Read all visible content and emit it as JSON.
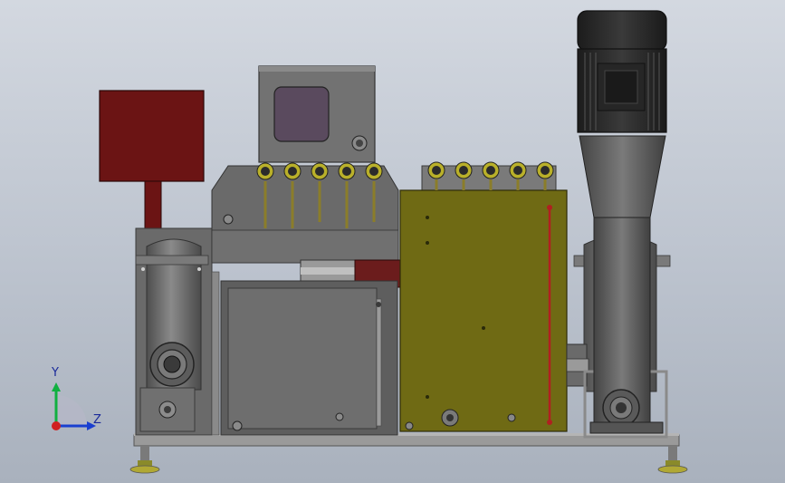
{
  "viewport": {
    "background_top": "#d3d8e0",
    "background_bottom": "#a9b1bd"
  },
  "colors": {
    "steel": "#6f6f6f",
    "steel_dark": "#4a4a4a",
    "steel_light": "#8c8c8c",
    "frame": "#9a9a9a",
    "maroon": "#6b1414",
    "olive": "#6f6a14",
    "motor": "#2a2a2a",
    "window": "#5a4a5e",
    "gauge": "#b9b02a",
    "pipe": "#8b7d2a",
    "red_line": "#b02020",
    "axis_x": "#1a3fd0",
    "axis_y": "#10b040",
    "axis_z": "#d02020"
  },
  "triad": {
    "y_label": "Y",
    "z_label": "Z"
  }
}
